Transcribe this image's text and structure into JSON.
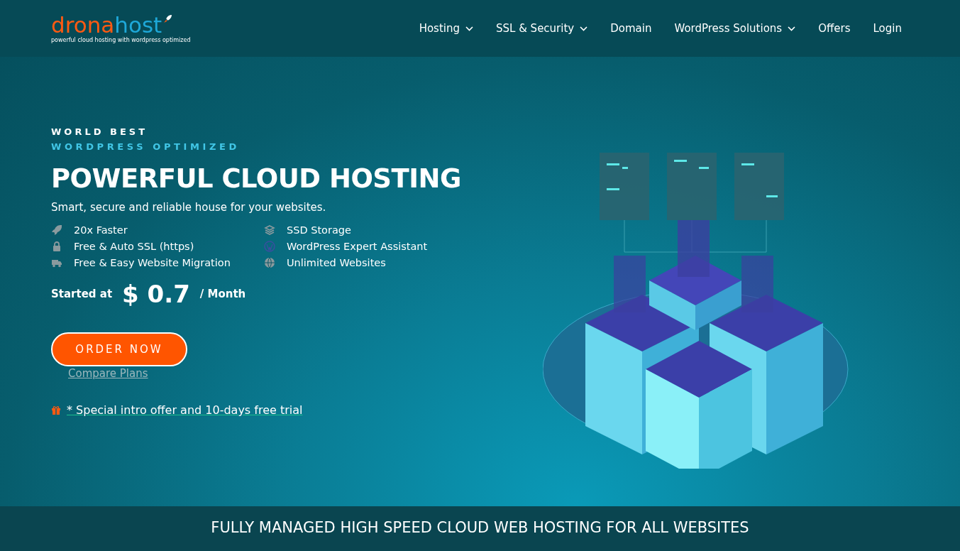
{
  "logo": {
    "name_parts": [
      "drona",
      "host"
    ],
    "tagline": "powerful cloud hosting with wordpress optimized"
  },
  "nav": [
    {
      "label": "Hosting",
      "has_menu": true
    },
    {
      "label": "SSL & Security",
      "has_menu": true
    },
    {
      "label": "Domain",
      "has_menu": false
    },
    {
      "label": "WordPress Solutions",
      "has_menu": true
    },
    {
      "label": "Offers",
      "has_menu": false
    },
    {
      "label": "Login",
      "has_menu": false
    }
  ],
  "hero": {
    "eyebrow": "WORLD BEST",
    "eyebrow_accent": "WORDPRESS OPTIMIZED",
    "title": "POWERFUL CLOUD HOSTING",
    "subtitle": "Smart, secure and reliable house for your websites.",
    "features": [
      {
        "kind": "rocket",
        "label": "20x Faster"
      },
      {
        "kind": "layers",
        "label": "SSD Storage"
      },
      {
        "kind": "lock",
        "label": "Free & Auto SSL (https)"
      },
      {
        "kind": "wordpress",
        "label": "WordPress Expert Assistant"
      },
      {
        "kind": "truck",
        "label": "Free & Easy Website Migration"
      },
      {
        "kind": "globe",
        "label": "Unlimited Websites"
      }
    ],
    "price_prefix": "Started at",
    "price": "$ 0.7",
    "price_period": "/ Month",
    "order_button": "ORDER NOW",
    "compare_link": "Compare Plans",
    "offer_link": "* Special intro offer and 10-days free trial"
  },
  "banner": "FULLY MANAGED HIGH SPEED CLOUD WEB HOSTING FOR ALL WEBSITES"
}
